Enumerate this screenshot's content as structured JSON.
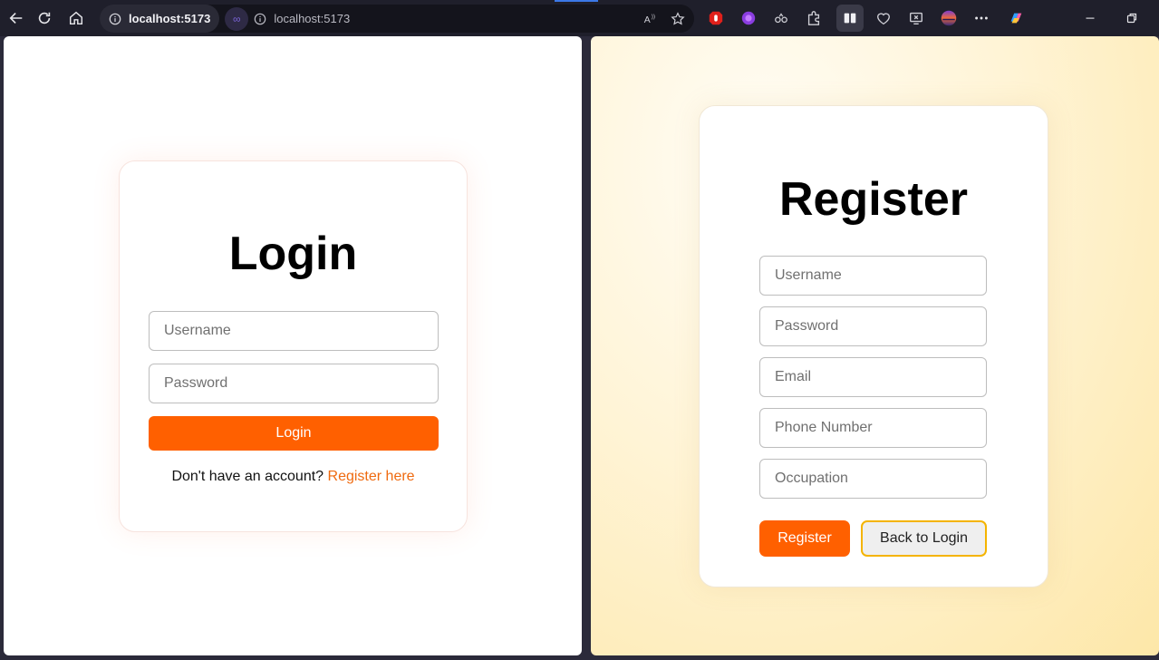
{
  "browser": {
    "address_host": "localhost:5173",
    "address_url": "localhost:5173",
    "icons": [
      "back-icon",
      "refresh-icon",
      "home-icon",
      "info-icon",
      "read-aloud-icon",
      "favorite-star-icon",
      "extensions-icon",
      "split-screen-icon",
      "health-icon",
      "screenshot-icon",
      "profile-avatar",
      "more-icon",
      "copilot-icon"
    ]
  },
  "login": {
    "title": "Login",
    "username_placeholder": "Username",
    "password_placeholder": "Password",
    "submit_label": "Login",
    "prompt_text": "Don't have an account?",
    "register_link": "Register here"
  },
  "register": {
    "title": "Register",
    "fields": {
      "username": "Username",
      "password": "Password",
      "email": "Email",
      "phone": "Phone Number",
      "occupation": "Occupation"
    },
    "submit_label": "Register",
    "back_label": "Back to Login"
  },
  "colors": {
    "accent": "#ff6000",
    "link": "#ef6a0f",
    "outline": "#f4b400"
  }
}
